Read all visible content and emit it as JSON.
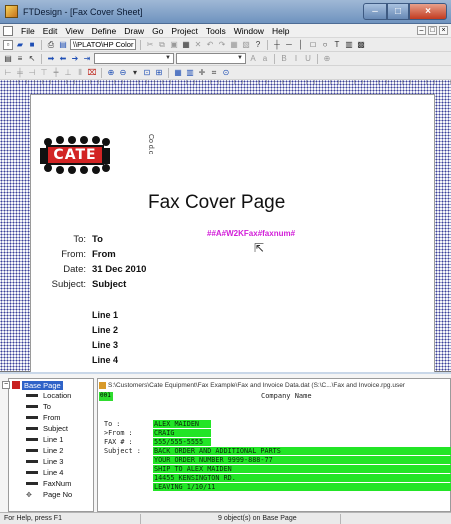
{
  "window": {
    "title": "FTDesign - [Fax Cover Sheet]",
    "minimize": "–",
    "maximize": "□",
    "close": "×"
  },
  "menu": {
    "items": [
      "File",
      "Edit",
      "View",
      "Define",
      "Draw",
      "Go",
      "Project",
      "Tools",
      "Window",
      "Help"
    ],
    "mdi_min": "–",
    "mdi_max": "□",
    "mdi_close": "×"
  },
  "toolbar": {
    "printer_combo": "\\\\PLATO\\HP Color Las"
  },
  "document": {
    "logo_text": "CATE",
    "logo_side_text": "Co",
    "logo_side_text2": "d.c",
    "title": "Fax Cover Page",
    "fax_number_field": "##A#W2KFax#faxnum#",
    "fields": [
      {
        "label": "To:",
        "value": "To"
      },
      {
        "label": "From:",
        "value": "From"
      },
      {
        "label": "Date:",
        "value": "31 Dec 2010"
      },
      {
        "label": "Subject:",
        "value": "Subject"
      }
    ],
    "lines": [
      "Line 1",
      "Line 2",
      "Line 3",
      "Line 4"
    ]
  },
  "tree": {
    "root": "Base Page",
    "items": [
      "Location",
      "To",
      "From",
      "Subject",
      "Line 1",
      "Line 2",
      "Line 3",
      "Line 4",
      "FaxNum",
      "Page No"
    ]
  },
  "database": {
    "path": "S:\\Customers\\Cate Equipment\\Fax Example\\Fax and Invoice Data.dat (S:\\C...\\Fax and Invoice.rpg.user",
    "record_number": "001",
    "company_name_header": "Company Name",
    "rows": [
      {
        "label": "To       :",
        "value": "ALEX MAIDEN"
      },
      {
        "label": ">From    :",
        "value": "CRAIG"
      },
      {
        "label": "FAX #    :",
        "value": "555/555-5555"
      },
      {
        "label": "Subject  :",
        "value": "BACK ORDER AND ADDITIONAL PARTS"
      },
      {
        "label": "",
        "value": "YOUR ORDER NUMBER 9999-888-77"
      },
      {
        "label": "",
        "value": "SHIP TO ALEX MAIDEN"
      },
      {
        "label": "",
        "value": "14455 KENSINGTON RD."
      },
      {
        "label": "",
        "value": "LEAVING 1/10/11"
      }
    ]
  },
  "status": {
    "help": "For Help, press F1",
    "objects": "9 object(s) on Base Page"
  }
}
